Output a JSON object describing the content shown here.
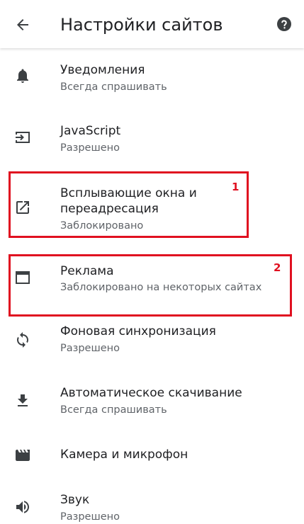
{
  "header": {
    "title": "Настройки сайтов",
    "back_icon": "arrow-back-icon",
    "help_icon": "help-circle-icon"
  },
  "items": [
    {
      "label": "Уведомления",
      "sub": "Всегда спрашивать",
      "icon": "bell-icon"
    },
    {
      "label": "JavaScript",
      "sub": "Разрешено",
      "icon": "javascript-icon"
    },
    {
      "label": "Всплывающие окна и",
      "label2": "переадресация",
      "sub": "Заблокировано",
      "icon": "open-in-new-icon"
    },
    {
      "label": "Реклама",
      "sub": "Заблокировано на некоторых сайтах",
      "icon": "window-icon"
    },
    {
      "label": "Фоновая синхронизация",
      "sub": "Разрешено",
      "icon": "sync-icon"
    },
    {
      "label": "Автоматическое скачивание",
      "sub": "Всегда спрашивать",
      "icon": "download-icon"
    },
    {
      "label": "Камера и микрофон",
      "icon": "camera-icon"
    },
    {
      "label": "Звук",
      "sub": "Разрешено",
      "icon": "volume-icon"
    }
  ],
  "annotations": [
    {
      "number": "1"
    },
    {
      "number": "2"
    }
  ],
  "colors": {
    "annotation": "#e01020",
    "primary_text": "#202124",
    "secondary_text": "#5f6368",
    "icon": "#3c4043"
  }
}
